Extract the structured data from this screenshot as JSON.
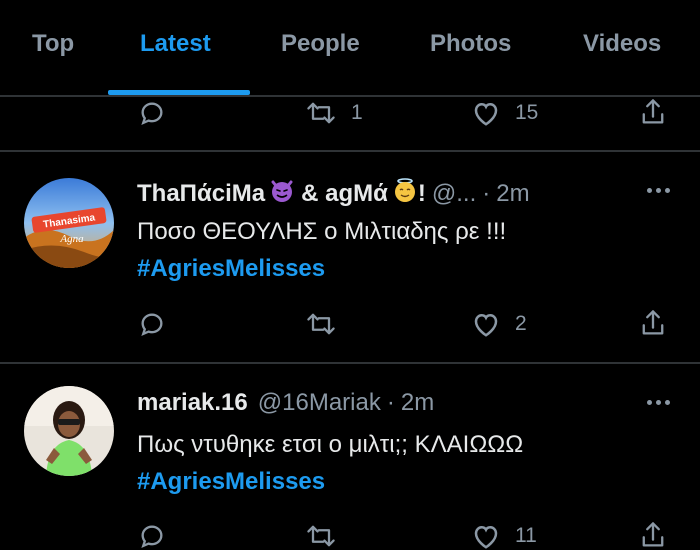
{
  "tabs": [
    {
      "label": "Top"
    },
    {
      "label": "Latest"
    },
    {
      "label": "People"
    },
    {
      "label": "Photos"
    },
    {
      "label": "Videos"
    }
  ],
  "active_tab": "Latest",
  "top_tweet_actions": {
    "retweet_count": "1",
    "like_count": "15"
  },
  "tweets": [
    {
      "display_name": "ThaΠάciΜa",
      "name_part2": "& agΜά",
      "name_end": "!",
      "handle": "@...",
      "separator": "·",
      "time": "2m",
      "text": "Ποσο ΘΕΟΥΛΗΣ ο Μιλτιαδης ρε !!!",
      "hashtag": "#AgriesMelisses",
      "retweet_count": "",
      "like_count": "2",
      "avatar_text": "Thanasima Agna"
    },
    {
      "display_name": "mariak.16",
      "handle": "@16Mariak",
      "separator": "·",
      "time": "2m",
      "text": "Πως ντυθηκε ετσι ο μιλτι;; ΚΛΑΙΩΩΩ",
      "hashtag": "#AgriesMelisses",
      "retweet_count": "",
      "like_count": "11"
    }
  ],
  "colors": {
    "background": "#000000",
    "accent": "#1d9bf0",
    "muted": "#8b98a5",
    "text": "#e7e9ea",
    "divider": "#2f3336"
  }
}
